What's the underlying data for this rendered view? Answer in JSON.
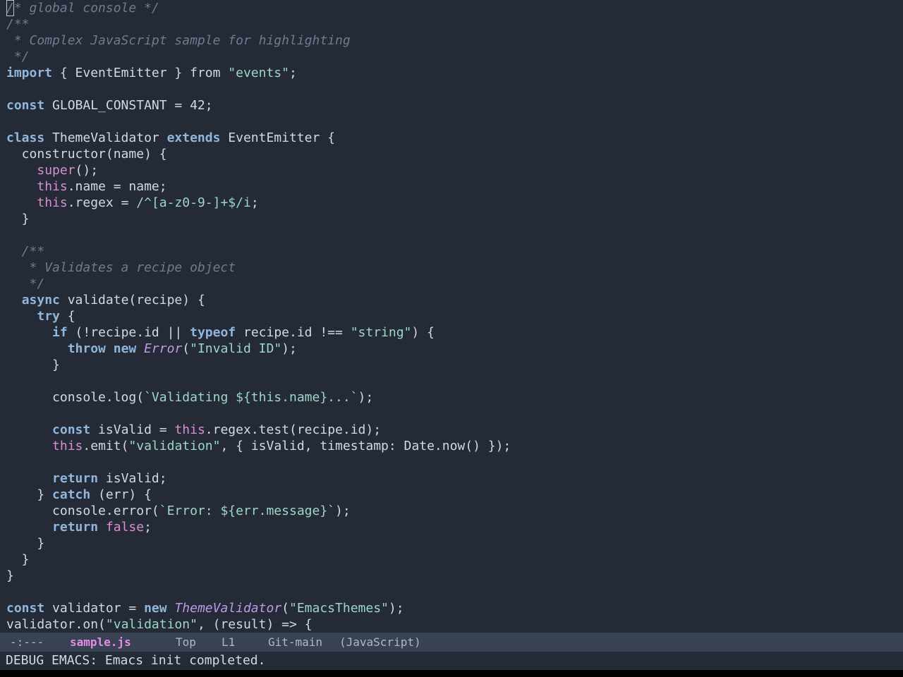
{
  "editor": {
    "file_name": "sample.js",
    "lines": [
      [
        {
          "t": "/",
          "c": "comment",
          "cursor": true
        },
        {
          "t": "* global console */",
          "c": "comment"
        }
      ],
      [
        {
          "t": "/**",
          "c": "comment"
        }
      ],
      [
        {
          "t": " * Complex JavaScript sample for highlighting",
          "c": "comment"
        }
      ],
      [
        {
          "t": " */",
          "c": "comment"
        }
      ],
      [
        {
          "t": "import",
          "c": "keyword"
        },
        {
          "t": " { EventEmitter } from ",
          "c": "plain"
        },
        {
          "t": "\"events\"",
          "c": "string"
        },
        {
          "t": ";",
          "c": "plain"
        }
      ],
      [],
      [
        {
          "t": "const",
          "c": "keyword"
        },
        {
          "t": " GLOBAL_CONSTANT = 42;",
          "c": "plain"
        }
      ],
      [],
      [
        {
          "t": "class",
          "c": "keyword"
        },
        {
          "t": " ThemeValidator ",
          "c": "plain"
        },
        {
          "t": "extends",
          "c": "keyword"
        },
        {
          "t": " EventEmitter {",
          "c": "plain"
        }
      ],
      [
        {
          "t": "  constructor(name) {",
          "c": "plain"
        }
      ],
      [
        {
          "t": "    ",
          "c": "plain"
        },
        {
          "t": "super",
          "c": "this"
        },
        {
          "t": "();",
          "c": "plain"
        }
      ],
      [
        {
          "t": "    ",
          "c": "plain"
        },
        {
          "t": "this",
          "c": "this"
        },
        {
          "t": ".name = name;",
          "c": "plain"
        }
      ],
      [
        {
          "t": "    ",
          "c": "plain"
        },
        {
          "t": "this",
          "c": "this"
        },
        {
          "t": ".regex = ",
          "c": "plain"
        },
        {
          "t": "/^[a-z0-9-]+$/i",
          "c": "string"
        },
        {
          "t": ";",
          "c": "plain"
        }
      ],
      [
        {
          "t": "  }",
          "c": "plain"
        }
      ],
      [],
      [
        {
          "t": "  /**",
          "c": "comment"
        }
      ],
      [
        {
          "t": "   * Validates a recipe object",
          "c": "comment"
        }
      ],
      [
        {
          "t": "   */",
          "c": "comment"
        }
      ],
      [
        {
          "t": "  ",
          "c": "plain"
        },
        {
          "t": "async",
          "c": "keyword"
        },
        {
          "t": " validate(recipe) {",
          "c": "plain"
        }
      ],
      [
        {
          "t": "    ",
          "c": "plain"
        },
        {
          "t": "try",
          "c": "keyword"
        },
        {
          "t": " {",
          "c": "plain"
        }
      ],
      [
        {
          "t": "      ",
          "c": "plain"
        },
        {
          "t": "if",
          "c": "keyword"
        },
        {
          "t": " (!recipe.id || ",
          "c": "plain"
        },
        {
          "t": "typeof",
          "c": "keyword"
        },
        {
          "t": " recipe.id !== ",
          "c": "plain"
        },
        {
          "t": "\"string\"",
          "c": "string"
        },
        {
          "t": ") {",
          "c": "plain"
        }
      ],
      [
        {
          "t": "        ",
          "c": "plain"
        },
        {
          "t": "throw",
          "c": "keyword"
        },
        {
          "t": " ",
          "c": "plain"
        },
        {
          "t": "new",
          "c": "keyword"
        },
        {
          "t": " ",
          "c": "plain"
        },
        {
          "t": "Error",
          "c": "type"
        },
        {
          "t": "(",
          "c": "plain"
        },
        {
          "t": "\"Invalid ID\"",
          "c": "string"
        },
        {
          "t": ");",
          "c": "plain"
        }
      ],
      [
        {
          "t": "      }",
          "c": "plain"
        }
      ],
      [],
      [
        {
          "t": "      console.log(",
          "c": "plain"
        },
        {
          "t": "`Validating ${this.name}...`",
          "c": "string"
        },
        {
          "t": ");",
          "c": "plain"
        }
      ],
      [],
      [
        {
          "t": "      ",
          "c": "plain"
        },
        {
          "t": "const",
          "c": "keyword"
        },
        {
          "t": " isValid = ",
          "c": "plain"
        },
        {
          "t": "this",
          "c": "this"
        },
        {
          "t": ".regex.test(recipe.id);",
          "c": "plain"
        }
      ],
      [
        {
          "t": "      ",
          "c": "plain"
        },
        {
          "t": "this",
          "c": "this"
        },
        {
          "t": ".emit(",
          "c": "plain"
        },
        {
          "t": "\"validation\"",
          "c": "string"
        },
        {
          "t": ", { isValid, timestamp: Date.now() });",
          "c": "plain"
        }
      ],
      [],
      [
        {
          "t": "      ",
          "c": "plain"
        },
        {
          "t": "return",
          "c": "keyword"
        },
        {
          "t": " isValid;",
          "c": "plain"
        }
      ],
      [
        {
          "t": "    } ",
          "c": "plain"
        },
        {
          "t": "catch",
          "c": "keyword"
        },
        {
          "t": " (err) {",
          "c": "plain"
        }
      ],
      [
        {
          "t": "      console.error(",
          "c": "plain"
        },
        {
          "t": "`Error: ${err.message}`",
          "c": "string"
        },
        {
          "t": ");",
          "c": "plain"
        }
      ],
      [
        {
          "t": "      ",
          "c": "plain"
        },
        {
          "t": "return",
          "c": "keyword"
        },
        {
          "t": " ",
          "c": "plain"
        },
        {
          "t": "false",
          "c": "this"
        },
        {
          "t": ";",
          "c": "plain"
        }
      ],
      [
        {
          "t": "    }",
          "c": "plain"
        }
      ],
      [
        {
          "t": "  }",
          "c": "plain"
        }
      ],
      [
        {
          "t": "}",
          "c": "plain"
        }
      ],
      [],
      [
        {
          "t": "const",
          "c": "keyword"
        },
        {
          "t": " validator = ",
          "c": "plain"
        },
        {
          "t": "new",
          "c": "keyword"
        },
        {
          "t": " ",
          "c": "plain"
        },
        {
          "t": "ThemeValidator",
          "c": "type"
        },
        {
          "t": "(",
          "c": "plain"
        },
        {
          "t": "\"EmacsThemes\"",
          "c": "string"
        },
        {
          "t": ");",
          "c": "plain"
        }
      ],
      [
        {
          "t": "validator.on(",
          "c": "plain"
        },
        {
          "t": "\"validation\"",
          "c": "string"
        },
        {
          "t": ", (result) => {",
          "c": "plain"
        }
      ]
    ]
  },
  "modeline": {
    "status": "-:---",
    "buffer": "sample.js",
    "position": "Top",
    "line": "L1",
    "vcs": "Git-main",
    "mode": "(JavaScript)"
  },
  "echo_area": {
    "message": "DEBUG EMACS: Emacs init completed."
  },
  "colors": {
    "background": "#242a36",
    "modeline_background": "#394252",
    "comment": "#6f7b8f",
    "keyword": "#90b6dc",
    "string": "#9cd7c7",
    "this_literal": "#d98fd1",
    "type": "#bd9ae8",
    "buffer_name": "#e48de5"
  }
}
